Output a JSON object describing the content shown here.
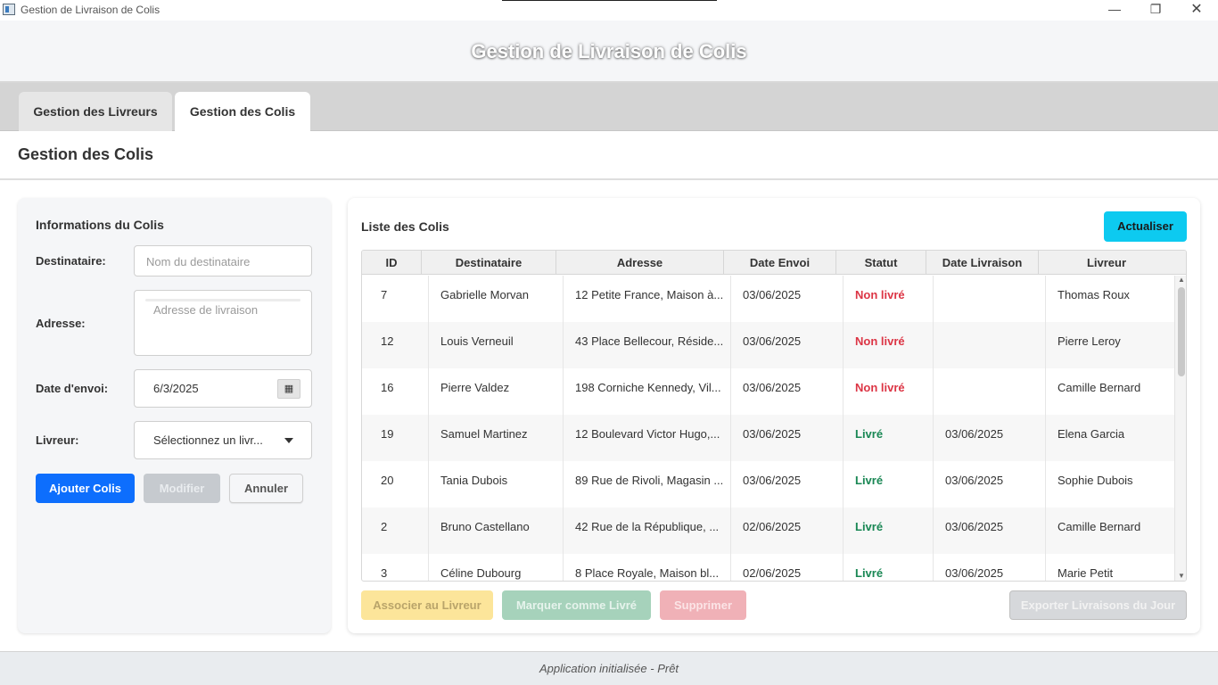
{
  "window": {
    "title": "Gestion de Livraison de Colis",
    "min_glyph": "—",
    "max_glyph": "❐",
    "close_glyph": "✕"
  },
  "banner": {
    "title": "Gestion de Livraison de Colis"
  },
  "tabs": [
    {
      "label": "Gestion des Livreurs",
      "active": false
    },
    {
      "label": "Gestion des Colis",
      "active": true
    }
  ],
  "page": {
    "title": "Gestion des Colis"
  },
  "form": {
    "title": "Informations du Colis",
    "destinataire": {
      "label": "Destinataire:",
      "placeholder": "Nom du destinataire",
      "value": ""
    },
    "adresse": {
      "label": "Adresse:",
      "placeholder": "Adresse de livraison",
      "value": ""
    },
    "date_envoi": {
      "label": "Date d'envoi:",
      "value": "6/3/2025",
      "icon": "calendar-icon",
      "icon_glyph": "▦"
    },
    "livreur": {
      "label": "Livreur:",
      "selected": "Sélectionnez un livr...",
      "icon": "chevron-down-icon"
    },
    "buttons": {
      "add": "Ajouter Colis",
      "edit": "Modifier",
      "cancel": "Annuler"
    }
  },
  "list": {
    "title": "Liste des Colis",
    "refresh_label": "Actualiser",
    "columns": [
      "ID",
      "Destinataire",
      "Adresse",
      "Date Envoi",
      "Statut",
      "Date Livraison",
      "Livreur"
    ],
    "rows": [
      {
        "id": "7",
        "destinataire": "Gabrielle Morvan",
        "adresse": "12 Petite France, Maison à...",
        "date_envoi": "03/06/2025",
        "statut": "Non livré",
        "date_livraison": "",
        "livreur": "Thomas Roux"
      },
      {
        "id": "12",
        "destinataire": "Louis Verneuil",
        "adresse": "43 Place Bellecour, Réside...",
        "date_envoi": "03/06/2025",
        "statut": "Non livré",
        "date_livraison": "",
        "livreur": "Pierre Leroy"
      },
      {
        "id": "16",
        "destinataire": "Pierre Valdez",
        "adresse": "198 Corniche Kennedy, Vil...",
        "date_envoi": "03/06/2025",
        "statut": "Non livré",
        "date_livraison": "",
        "livreur": "Camille Bernard"
      },
      {
        "id": "19",
        "destinataire": "Samuel Martinez",
        "adresse": "12 Boulevard Victor Hugo,...",
        "date_envoi": "03/06/2025",
        "statut": "Livré",
        "date_livraison": "03/06/2025",
        "livreur": "Elena Garcia"
      },
      {
        "id": "20",
        "destinataire": "Tania Dubois",
        "adresse": "89 Rue de Rivoli, Magasin ...",
        "date_envoi": "03/06/2025",
        "statut": "Livré",
        "date_livraison": "03/06/2025",
        "livreur": "Sophie Dubois"
      },
      {
        "id": "2",
        "destinataire": "Bruno Castellano",
        "adresse": "42 Rue de la République, ...",
        "date_envoi": "02/06/2025",
        "statut": "Livré",
        "date_livraison": "03/06/2025",
        "livreur": "Camille Bernard"
      },
      {
        "id": "3",
        "destinataire": "Céline Dubourg",
        "adresse": "8 Place Royale, Maison bl...",
        "date_envoi": "02/06/2025",
        "statut": "Livré",
        "date_livraison": "03/06/2025",
        "livreur": "Marie Petit"
      }
    ],
    "actions": {
      "associate": "Associer au Livreur",
      "mark_delivered": "Marquer comme Livré",
      "delete": "Supprimer",
      "export": "Exporter Livraisons du Jour"
    },
    "scroll_up_glyph": "▲",
    "scroll_down_glyph": "▼"
  },
  "status_bar": {
    "text": "Application initialisée - Prêt"
  },
  "colors": {
    "primary": "#0d6efd",
    "info": "#0dcaf0",
    "status_not_delivered": "#dc3545",
    "status_delivered": "#198754"
  }
}
